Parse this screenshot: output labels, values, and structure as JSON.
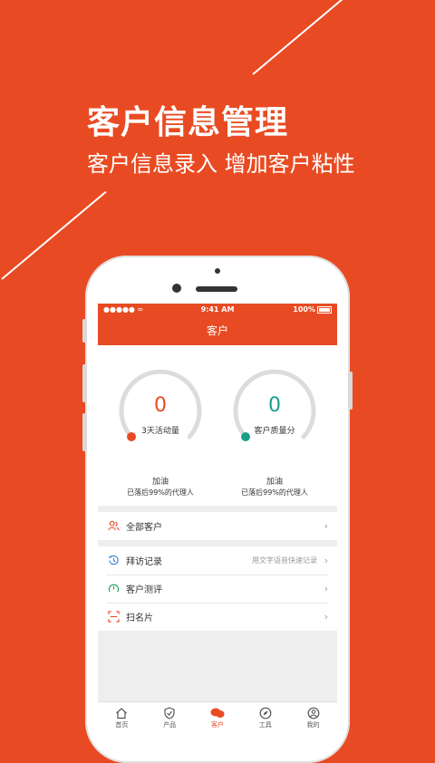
{
  "hero": {
    "title": "客户信息管理",
    "subtitle": "客户信息录入  增加客户粘性"
  },
  "colors": {
    "brand": "#e84b23",
    "teal": "#1a9e8a"
  },
  "status_bar": {
    "signal": "●●●●● ",
    "time": "9:41 AM",
    "battery": "100%"
  },
  "nav": {
    "title": "客户"
  },
  "stats": [
    {
      "value": "0",
      "label": "3天活动量",
      "encourage": "加油",
      "rank": "已落后99%的代理人",
      "color": "#e84b23"
    },
    {
      "value": "0",
      "label": "客户质量分",
      "encourage": "加油",
      "rank": "已落后99%的代理人",
      "color": "#1a9e8a"
    }
  ],
  "all_customers": {
    "label": "全部客户",
    "icon": "users-icon"
  },
  "menu": [
    {
      "label": "拜访记录",
      "hint": "用文字语音快速记录",
      "icon": "history-icon"
    },
    {
      "label": "客户测评",
      "icon": "gauge-icon"
    },
    {
      "label": "扫名片",
      "icon": "scan-icon"
    }
  ],
  "tabs": [
    {
      "label": "首页",
      "icon": "home-icon"
    },
    {
      "label": "产品",
      "icon": "shield-icon"
    },
    {
      "label": "客户",
      "icon": "customer-chat-icon",
      "active": true
    },
    {
      "label": "工具",
      "icon": "compass-icon"
    },
    {
      "label": "我的",
      "icon": "profile-icon"
    }
  ]
}
